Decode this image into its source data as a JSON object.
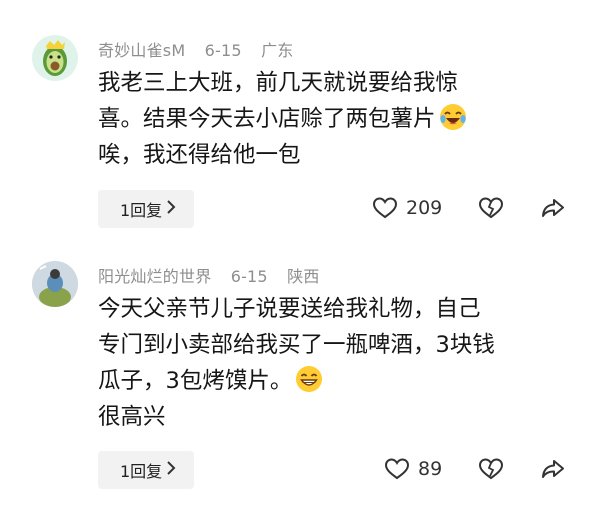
{
  "comments": [
    {
      "username": "奇妙山雀sM",
      "date": "6-15",
      "location": "广东",
      "lines": [
        "我老三上大班，前几天就说要给我惊",
        "喜。结果今天去小店赊了两包薯片",
        "唉，我还得给他一包"
      ],
      "emoji": "laughing-tears-emoji",
      "reply_label": "1回复",
      "likes": "209"
    },
    {
      "username": "阳光灿烂的世界",
      "date": "6-15",
      "location": "陕西",
      "lines": [
        "今天父亲节儿子说要送给我礼物，自己",
        "专门到小卖部给我买了一瓶啤酒，3块钱",
        "瓜子，3包烤馍片。",
        "很高兴"
      ],
      "emoji": "grinning-emoji",
      "reply_label": "1回复",
      "likes": "89"
    }
  ],
  "icons": {
    "reply_chevron": "chevron-right-icon",
    "like": "heart-icon",
    "dislike": "broken-heart-icon",
    "share": "share-arrow-icon"
  },
  "colors": {
    "meta": "#8e8e8e",
    "text": "#161616",
    "reply_bg": "#f2f2f2",
    "emoji_yellow": "#ffcc33"
  }
}
